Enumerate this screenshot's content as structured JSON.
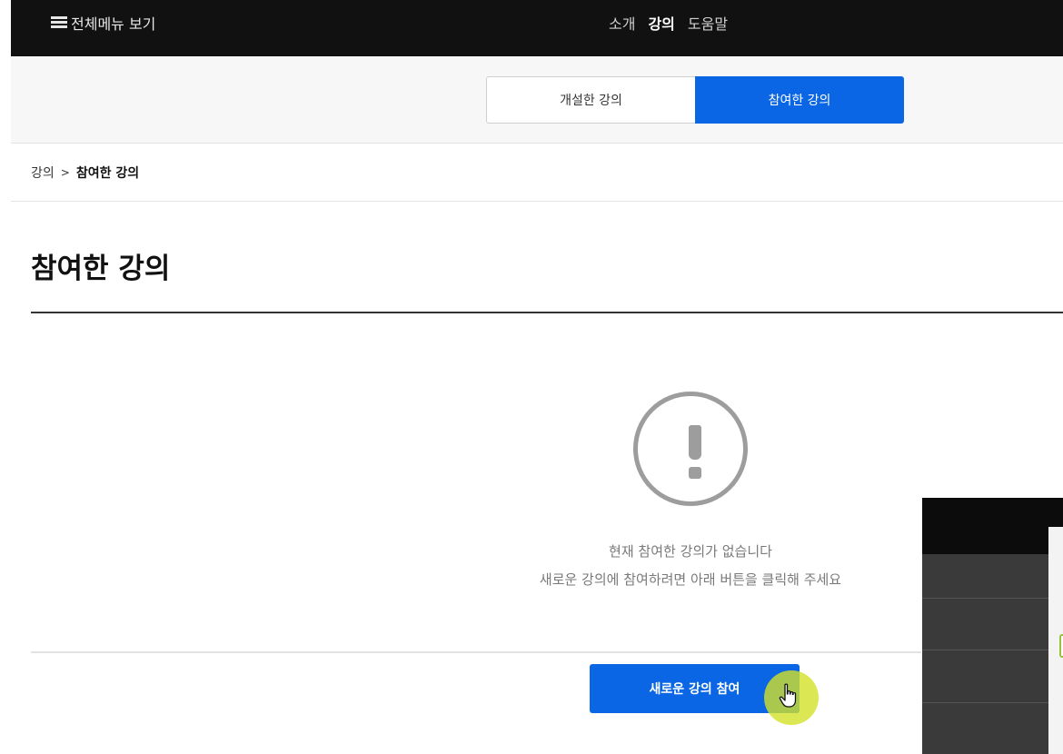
{
  "topbar": {
    "menu_label": "전체메뉴 보기",
    "nav": [
      "소개",
      "강의",
      "도움말"
    ],
    "active_nav": "강의"
  },
  "tabs": {
    "created_label": "개설한 강의",
    "joined_label": "참여한 강의",
    "active": "참여한 강의"
  },
  "breadcrumb": {
    "root": "강의",
    "separator": ">",
    "current": "참여한 강의"
  },
  "page": {
    "title": "참여한 강의"
  },
  "empty_state": {
    "icon": "exclamation-circle-icon",
    "line1": "현재 참여한 강의가 없습니다",
    "line2": "새로운 강의에 참여하려면 아래 버튼을 클릭해 주세요"
  },
  "join_button": {
    "label": "새로운 강의 참여"
  },
  "colors": {
    "accent": "#0a66e4",
    "topbar": "#111111",
    "cursor_highlight": "#d2e128"
  }
}
